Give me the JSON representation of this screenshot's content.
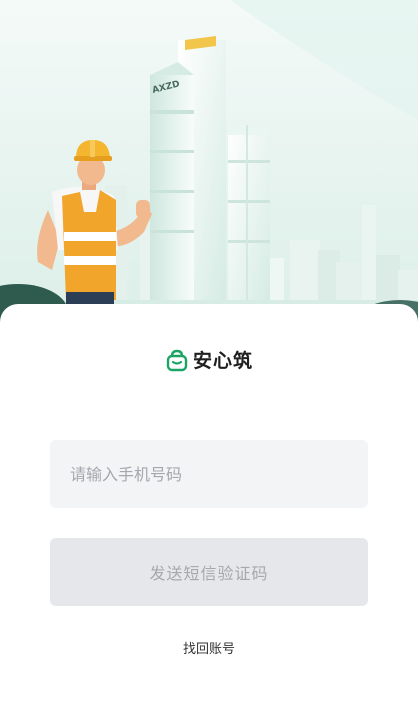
{
  "hero": {
    "building_sign": "AXZD"
  },
  "brand": {
    "logo_text": "安心筑",
    "icon": "shield-bag-icon",
    "accent": "#1aa564"
  },
  "login": {
    "phone_placeholder": "请输入手机号码",
    "phone_value": "",
    "send_code_label": "发送短信验证码",
    "recover_account_label": "找回账号"
  },
  "colors": {
    "field_bg": "#f3f4f6",
    "button_disabled_bg": "#e6e7ea",
    "vest": "#f2a52b",
    "helmet": "#f4b62e"
  }
}
